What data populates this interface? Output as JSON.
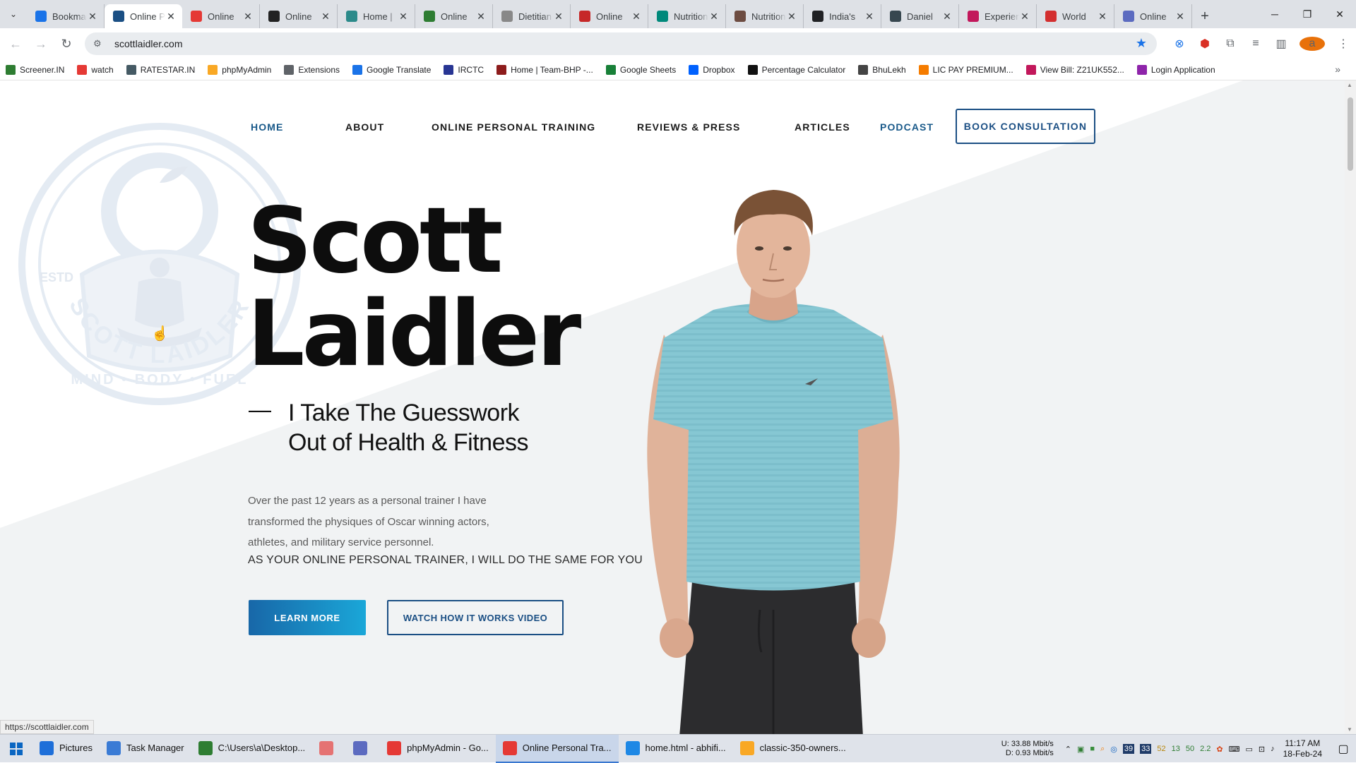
{
  "browser": {
    "tabs": [
      {
        "label": "Bookmarks",
        "icon": "star-icon",
        "color": "#1a73e8",
        "active": false
      },
      {
        "label": "Online Personal Training",
        "icon": "site-icon",
        "color": "#1b4f84",
        "active": true
      },
      {
        "label": "Online",
        "icon": "site-icon",
        "color": "#e53935",
        "active": false
      },
      {
        "label": "Online",
        "icon": "site-icon",
        "color": "#222222",
        "active": false
      },
      {
        "label": "Home |",
        "icon": "site-icon",
        "color": "#2b8a8a",
        "active": false
      },
      {
        "label": "Online",
        "icon": "site-icon",
        "color": "#2e7d32",
        "active": false
      },
      {
        "label": "Dietitian",
        "icon": "site-icon",
        "color": "#888888",
        "active": false
      },
      {
        "label": "Online",
        "icon": "site-icon",
        "color": "#c62828",
        "active": false
      },
      {
        "label": "Nutrition",
        "icon": "site-icon",
        "color": "#00897b",
        "active": false
      },
      {
        "label": "Nutrition",
        "icon": "site-icon",
        "color": "#6d4c41",
        "active": false
      },
      {
        "label": "India's",
        "icon": "map-pin-icon",
        "color": "#202124",
        "active": false
      },
      {
        "label": "Daniel",
        "icon": "site-icon",
        "color": "#37474f",
        "active": false
      },
      {
        "label": "Experience",
        "icon": "site-icon",
        "color": "#c2185b",
        "active": false
      },
      {
        "label": "World",
        "icon": "site-icon",
        "color": "#d32f2f",
        "active": false
      },
      {
        "label": "Online",
        "icon": "site-icon",
        "color": "#5c6bc0",
        "active": false
      }
    ],
    "url": "scottlaidler.com",
    "profile_initial": "a",
    "status_url": "https://scottlaidler.com"
  },
  "bookmarks": [
    {
      "label": "Screener.IN",
      "color": "#2e7d32"
    },
    {
      "label": "watch",
      "color": "#e53935"
    },
    {
      "label": "RATESTAR.IN",
      "color": "#455a64"
    },
    {
      "label": "phpMyAdmin",
      "color": "#f9a825"
    },
    {
      "label": "Extensions",
      "color": "#5f6368"
    },
    {
      "label": "Google Translate",
      "color": "#1a73e8"
    },
    {
      "label": "IRCTC",
      "color": "#283593"
    },
    {
      "label": "Home | Team-BHP -...",
      "color": "#8d1c1c"
    },
    {
      "label": "Google Sheets",
      "color": "#188038"
    },
    {
      "label": "Dropbox",
      "color": "#0061fe"
    },
    {
      "label": "Percentage Calculator",
      "color": "#111111"
    },
    {
      "label": "BhuLekh",
      "color": "#444444"
    },
    {
      "label": "LIC PAY PREMIUM...",
      "color": "#f57c00"
    },
    {
      "label": "View Bill: Z21UK552...",
      "color": "#c2185b"
    },
    {
      "label": "Login Application",
      "color": "#8e24aa"
    }
  ],
  "site": {
    "nav": [
      {
        "label": "HOME",
        "highlight": true
      },
      {
        "label": "ABOUT",
        "highlight": false
      },
      {
        "label": "ONLINE PERSONAL TRAINING",
        "highlight": false
      },
      {
        "label": "REVIEWS & PRESS",
        "highlight": false
      },
      {
        "label": "ARTICLES",
        "highlight": false
      },
      {
        "label": "PODCAST",
        "highlight": true
      }
    ],
    "book_label": "BOOK CONSULTATION",
    "hero_line1": "Scott",
    "hero_line2": "Laidler",
    "tagline_dash": "—",
    "tagline_line1": "I Take The Guesswork",
    "tagline_line2": "Out of Health & Fitness",
    "desc_line1": "Over the past 12 years as a personal trainer I have",
    "desc_line2": "transformed the physiques of Oscar winning actors,",
    "desc_line3": "athletes, and military service personnel.",
    "cta_line": "AS YOUR ONLINE PERSONAL TRAINER, I WILL DO THE SAME FOR YOU",
    "learn_more": "LEARN MORE",
    "watch_video": "WATCH HOW IT WORKS VIDEO",
    "logo_text_top": "SCOTT LAIDLER",
    "logo_text_bottom": "MIND • BODY • FUEL",
    "logo_estd": "ESTD"
  },
  "taskbar": {
    "items": [
      {
        "label": "Pictures",
        "color": "#1e6fd9",
        "active": false
      },
      {
        "label": "Task Manager",
        "color": "#3a7bd5",
        "active": false
      },
      {
        "label": "C:\\Users\\a\\Desktop...",
        "color": "#2e7d32",
        "active": false
      },
      {
        "label": "",
        "color": "#e57373",
        "active": false
      },
      {
        "label": "",
        "color": "#5c6bc0",
        "active": false
      },
      {
        "label": "phpMyAdmin - Go...",
        "color": "#e53935",
        "active": false
      },
      {
        "label": "Online Personal Tra...",
        "color": "#e53935",
        "active": true
      },
      {
        "label": "home.html - abhifi...",
        "color": "#1e88e5",
        "active": false
      },
      {
        "label": "classic-350-owners...",
        "color": "#f9a825",
        "active": false
      }
    ],
    "upload": "U:   33.88 Mbit/s",
    "download": "D:   0.93 Mbit/s",
    "tray_numbers": [
      "39",
      "33",
      "52",
      "13",
      "50",
      "2.2"
    ],
    "time": "11:17 AM",
    "date": "18-Feb-24"
  }
}
